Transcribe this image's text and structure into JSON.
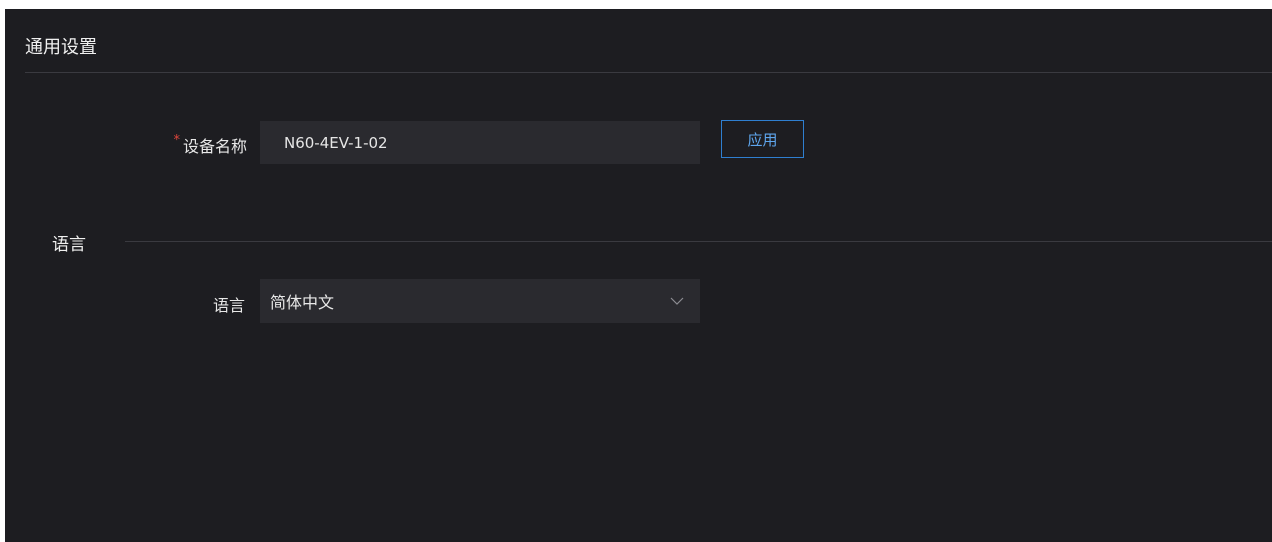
{
  "header": {
    "title": "通用设置"
  },
  "device_name": {
    "required_mark": "*",
    "label": "设备名称",
    "value": "N60-4EV-1-02",
    "apply_label": "应用"
  },
  "language_section": {
    "title": "语言",
    "field_label": "语言",
    "selected_value": "简体中文",
    "dropdown_icon": "chevron-down-icon"
  },
  "colors": {
    "background": "#1d1d21",
    "input_background": "#2a2a2f",
    "accent": "#2f7fd0",
    "required": "#e0463c"
  }
}
